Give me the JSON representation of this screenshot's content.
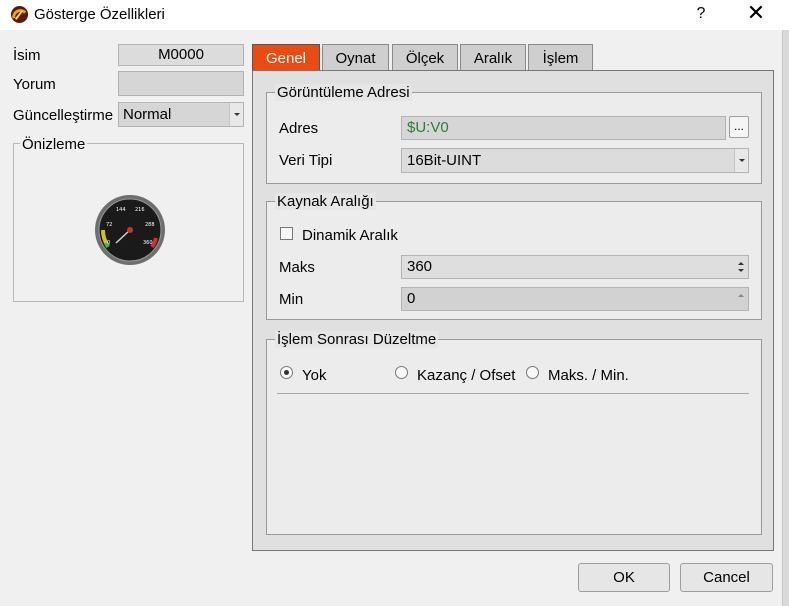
{
  "window": {
    "title": "Gösterge Özellikleri",
    "help": "?",
    "close": "✕"
  },
  "left": {
    "name_label": "İsim",
    "name_value": "M0000",
    "comment_label": "Yorum",
    "comment_value": "",
    "update_label": "Güncelleştirme",
    "update_value": "Normal",
    "preview_label": "Önizleme",
    "gauge_ticks": [
      "0",
      "72",
      "144",
      "216",
      "288",
      "360"
    ]
  },
  "tabs": [
    {
      "label": "Genel",
      "active": true
    },
    {
      "label": "Oynat",
      "active": false
    },
    {
      "label": "Ölçek",
      "active": false
    },
    {
      "label": "Aralık",
      "active": false
    },
    {
      "label": "İşlem",
      "active": false
    }
  ],
  "display_address": {
    "title": "Görüntüleme Adresi",
    "address_label": "Adres",
    "address_value": "$U:V0",
    "address_btn": "...",
    "type_label": "Veri Tipi",
    "type_value": "16Bit-UINT"
  },
  "source_range": {
    "title": "Kaynak Aralığı",
    "dynamic_label": "Dinamik Aralık",
    "dynamic_checked": false,
    "max_label": "Maks",
    "max_value": "360",
    "min_label": "Min",
    "min_value": "0"
  },
  "post_process": {
    "title": "İşlem Sonrası Düzeltme",
    "options": [
      {
        "label": "Yok",
        "selected": true
      },
      {
        "label": "Kazanç / Ofset",
        "selected": false
      },
      {
        "label": "Maks. / Min.",
        "selected": false
      }
    ]
  },
  "buttons": {
    "ok": "OK",
    "cancel": "Cancel"
  },
  "colors": {
    "active_tab": "#ea4b12",
    "address_text": "#2e7d32"
  }
}
